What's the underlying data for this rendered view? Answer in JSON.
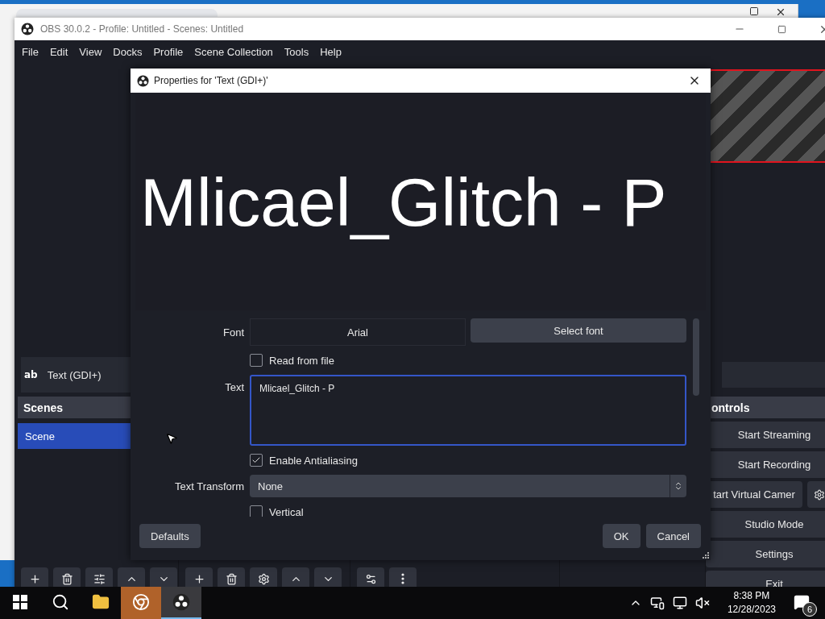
{
  "main_window": {
    "title": "OBS 30.0.2 - Profile: Untitled - Scenes: Untitled",
    "menu": [
      "File",
      "Edit",
      "View",
      "Docks",
      "Profile",
      "Scene Collection",
      "Tools",
      "Help"
    ],
    "context_bar": {
      "icon": "ab",
      "source": "Text (GDI+)"
    },
    "scenes": {
      "title": "Scenes",
      "items": [
        {
          "label": "Scene",
          "selected": true
        }
      ]
    },
    "controls": {
      "title": "ontrols",
      "buttons": [
        {
          "kind": "plain",
          "label": "Start Streaming"
        },
        {
          "kind": "plain",
          "label": "Start Recording"
        },
        {
          "kind": "split",
          "label": "tart Virtual Camer"
        },
        {
          "kind": "plain",
          "label": "Studio Mode"
        },
        {
          "kind": "plain",
          "label": "Settings"
        },
        {
          "kind": "plain",
          "label": "Exit"
        }
      ]
    }
  },
  "dialog": {
    "title": "Properties for 'Text (GDI+)'",
    "preview_text": "Mlicael_Glitch - P",
    "properties": [
      {
        "kind": "font",
        "label": "Font",
        "value": "Arial",
        "button": "Select font"
      },
      {
        "kind": "checkbox",
        "label": "Read from file",
        "checked": false
      },
      {
        "kind": "textarea",
        "label": "Text",
        "value": "Mlicael_Glitch - P"
      },
      {
        "kind": "checkbox",
        "label": "Enable Antialiasing",
        "checked": true
      },
      {
        "kind": "select",
        "label": "Text Transform",
        "value": "None"
      },
      {
        "kind": "checkbox",
        "label": "Vertical",
        "checked": false
      }
    ],
    "buttons": [
      {
        "kind": "left",
        "label": "Defaults"
      },
      {
        "kind": "right",
        "label": "OK"
      },
      {
        "kind": "right",
        "label": "Cancel"
      }
    ]
  },
  "taskbar": {
    "apps": [
      {
        "kind": "search",
        "active": false,
        "flashing": false
      },
      {
        "kind": "files",
        "active": false,
        "flashing": false
      },
      {
        "kind": "browser",
        "active": false,
        "flashing": true
      },
      {
        "kind": "obs",
        "active": true,
        "flashing": false
      }
    ],
    "clock": {
      "time": "8:38 PM",
      "date": "12/28/2023"
    },
    "notifications": {
      "count": "6"
    }
  }
}
